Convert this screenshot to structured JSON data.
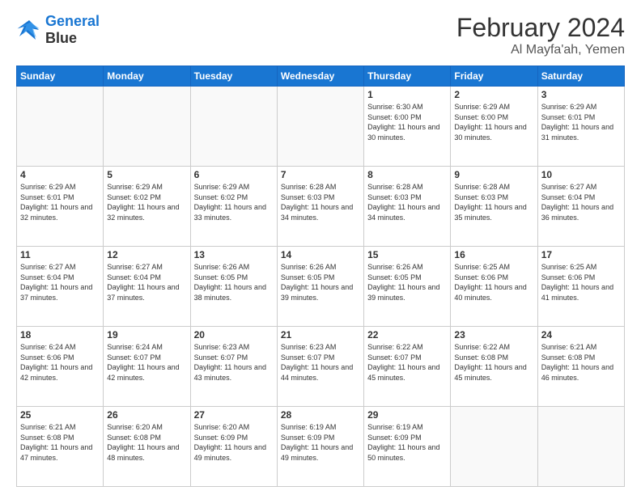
{
  "header": {
    "logo_line1": "General",
    "logo_line2": "Blue",
    "month": "February 2024",
    "location": "Al Mayfa'ah, Yemen"
  },
  "weekdays": [
    "Sunday",
    "Monday",
    "Tuesday",
    "Wednesday",
    "Thursday",
    "Friday",
    "Saturday"
  ],
  "weeks": [
    [
      {
        "day": "",
        "info": ""
      },
      {
        "day": "",
        "info": ""
      },
      {
        "day": "",
        "info": ""
      },
      {
        "day": "",
        "info": ""
      },
      {
        "day": "1",
        "info": "Sunrise: 6:30 AM\nSunset: 6:00 PM\nDaylight: 11 hours and 30 minutes."
      },
      {
        "day": "2",
        "info": "Sunrise: 6:29 AM\nSunset: 6:00 PM\nDaylight: 11 hours and 30 minutes."
      },
      {
        "day": "3",
        "info": "Sunrise: 6:29 AM\nSunset: 6:01 PM\nDaylight: 11 hours and 31 minutes."
      }
    ],
    [
      {
        "day": "4",
        "info": "Sunrise: 6:29 AM\nSunset: 6:01 PM\nDaylight: 11 hours and 32 minutes."
      },
      {
        "day": "5",
        "info": "Sunrise: 6:29 AM\nSunset: 6:02 PM\nDaylight: 11 hours and 32 minutes."
      },
      {
        "day": "6",
        "info": "Sunrise: 6:29 AM\nSunset: 6:02 PM\nDaylight: 11 hours and 33 minutes."
      },
      {
        "day": "7",
        "info": "Sunrise: 6:28 AM\nSunset: 6:03 PM\nDaylight: 11 hours and 34 minutes."
      },
      {
        "day": "8",
        "info": "Sunrise: 6:28 AM\nSunset: 6:03 PM\nDaylight: 11 hours and 34 minutes."
      },
      {
        "day": "9",
        "info": "Sunrise: 6:28 AM\nSunset: 6:03 PM\nDaylight: 11 hours and 35 minutes."
      },
      {
        "day": "10",
        "info": "Sunrise: 6:27 AM\nSunset: 6:04 PM\nDaylight: 11 hours and 36 minutes."
      }
    ],
    [
      {
        "day": "11",
        "info": "Sunrise: 6:27 AM\nSunset: 6:04 PM\nDaylight: 11 hours and 37 minutes."
      },
      {
        "day": "12",
        "info": "Sunrise: 6:27 AM\nSunset: 6:04 PM\nDaylight: 11 hours and 37 minutes."
      },
      {
        "day": "13",
        "info": "Sunrise: 6:26 AM\nSunset: 6:05 PM\nDaylight: 11 hours and 38 minutes."
      },
      {
        "day": "14",
        "info": "Sunrise: 6:26 AM\nSunset: 6:05 PM\nDaylight: 11 hours and 39 minutes."
      },
      {
        "day": "15",
        "info": "Sunrise: 6:26 AM\nSunset: 6:05 PM\nDaylight: 11 hours and 39 minutes."
      },
      {
        "day": "16",
        "info": "Sunrise: 6:25 AM\nSunset: 6:06 PM\nDaylight: 11 hours and 40 minutes."
      },
      {
        "day": "17",
        "info": "Sunrise: 6:25 AM\nSunset: 6:06 PM\nDaylight: 11 hours and 41 minutes."
      }
    ],
    [
      {
        "day": "18",
        "info": "Sunrise: 6:24 AM\nSunset: 6:06 PM\nDaylight: 11 hours and 42 minutes."
      },
      {
        "day": "19",
        "info": "Sunrise: 6:24 AM\nSunset: 6:07 PM\nDaylight: 11 hours and 42 minutes."
      },
      {
        "day": "20",
        "info": "Sunrise: 6:23 AM\nSunset: 6:07 PM\nDaylight: 11 hours and 43 minutes."
      },
      {
        "day": "21",
        "info": "Sunrise: 6:23 AM\nSunset: 6:07 PM\nDaylight: 11 hours and 44 minutes."
      },
      {
        "day": "22",
        "info": "Sunrise: 6:22 AM\nSunset: 6:07 PM\nDaylight: 11 hours and 45 minutes."
      },
      {
        "day": "23",
        "info": "Sunrise: 6:22 AM\nSunset: 6:08 PM\nDaylight: 11 hours and 45 minutes."
      },
      {
        "day": "24",
        "info": "Sunrise: 6:21 AM\nSunset: 6:08 PM\nDaylight: 11 hours and 46 minutes."
      }
    ],
    [
      {
        "day": "25",
        "info": "Sunrise: 6:21 AM\nSunset: 6:08 PM\nDaylight: 11 hours and 47 minutes."
      },
      {
        "day": "26",
        "info": "Sunrise: 6:20 AM\nSunset: 6:08 PM\nDaylight: 11 hours and 48 minutes."
      },
      {
        "day": "27",
        "info": "Sunrise: 6:20 AM\nSunset: 6:09 PM\nDaylight: 11 hours and 49 minutes."
      },
      {
        "day": "28",
        "info": "Sunrise: 6:19 AM\nSunset: 6:09 PM\nDaylight: 11 hours and 49 minutes."
      },
      {
        "day": "29",
        "info": "Sunrise: 6:19 AM\nSunset: 6:09 PM\nDaylight: 11 hours and 50 minutes."
      },
      {
        "day": "",
        "info": ""
      },
      {
        "day": "",
        "info": ""
      }
    ]
  ]
}
